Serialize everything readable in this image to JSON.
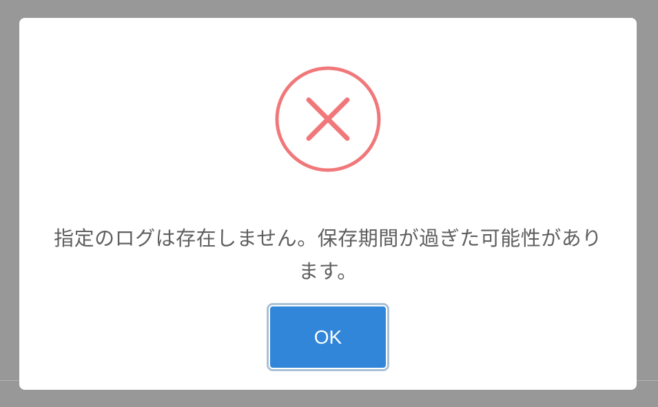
{
  "dialog": {
    "icon": "error-x-circle-icon",
    "icon_color": "#f0787a",
    "message_line1": "指定のログは存在しません。保存期間が過ぎた可能性があり",
    "message_line2": "ます。",
    "ok_label": "OK",
    "button_color": "#3186d9"
  }
}
